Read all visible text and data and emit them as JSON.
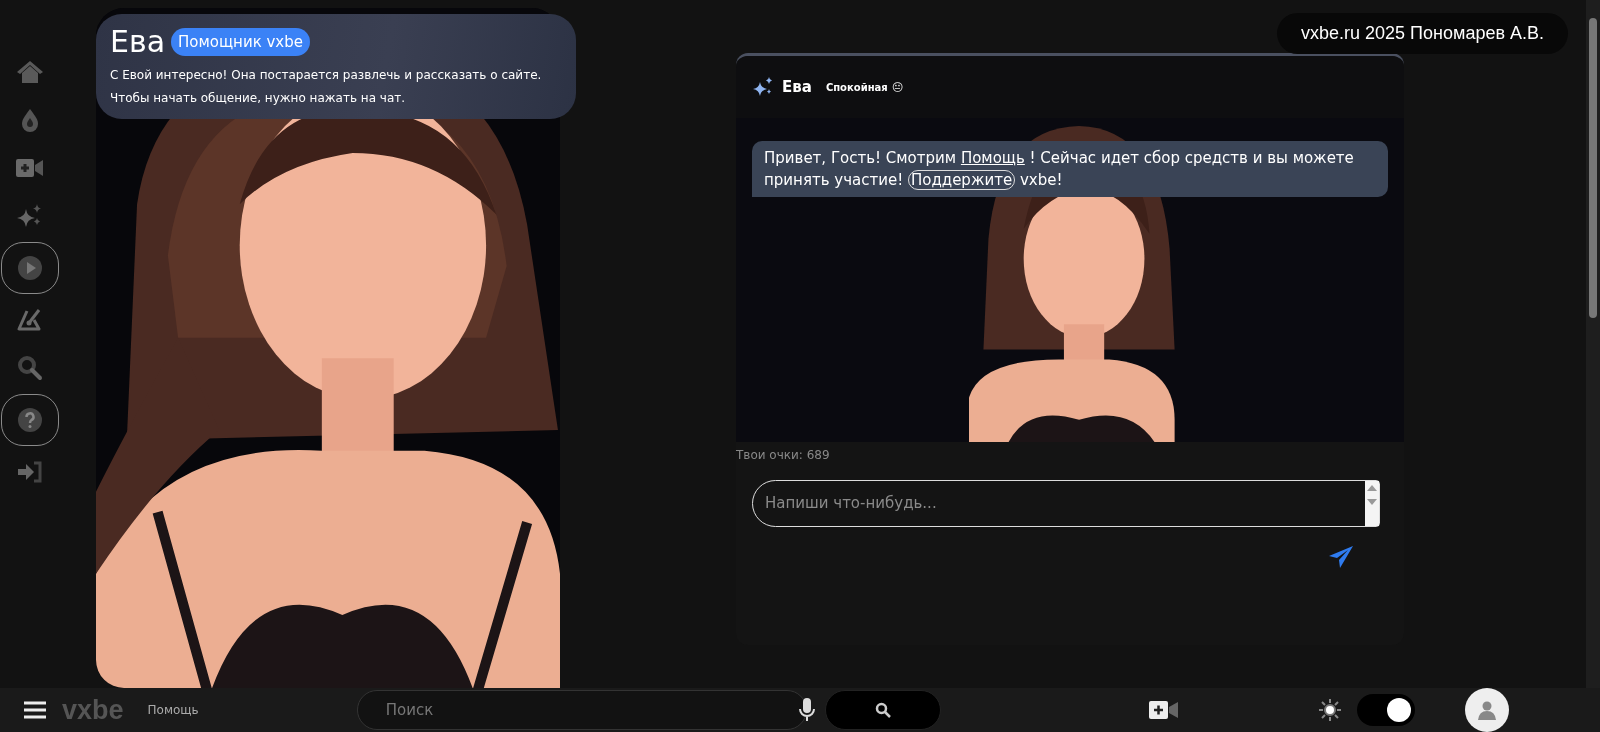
{
  "sidebar": {
    "items": [
      {
        "selected": false
      },
      {
        "selected": false
      },
      {
        "selected": false
      },
      {
        "selected": false
      },
      {
        "selected": true
      },
      {
        "selected": false
      },
      {
        "selected": false
      },
      {
        "selected": true
      },
      {
        "selected": false
      }
    ]
  },
  "credit": "vxbe.ru 2025 Пономарев А.В.",
  "intro": {
    "name": "Ева",
    "badge": "Помощник vxbe",
    "lines": [
      "С Евой интересно! Она постарается развлечь и рассказать о сайте.",
      "Чтобы начать общение, нужно нажать на чат."
    ]
  },
  "chat": {
    "name": "Ева",
    "mood": "Спокойная",
    "mood_emoji": "😐",
    "message": [
      {
        "kind": "text",
        "text": "Привет, Гость! Смотрим "
      },
      {
        "kind": "link",
        "text": "Помощь"
      },
      {
        "kind": "text",
        "text": " ! Сейчас идет сбор средств и вы можете принять участие! "
      },
      {
        "kind": "button",
        "text": "Поддержите"
      },
      {
        "kind": "text",
        "text": " vxbe!"
      }
    ],
    "points": "Твои очки: 689",
    "placeholder": "Напиши что-нибудь..."
  },
  "bottom_bar": {
    "logo": "vxbe",
    "section": "Помощь",
    "search_placeholder": "Поиск",
    "theme_toggle": {
      "on": true
    }
  }
}
